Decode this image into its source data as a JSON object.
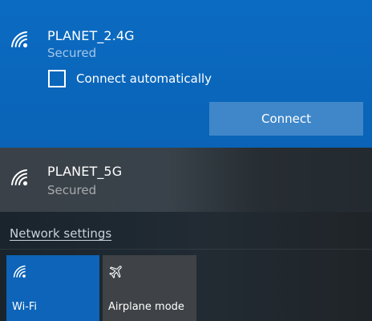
{
  "networks": [
    {
      "name": "PLANET_2.4G",
      "status": "Secured",
      "icon": "wifi-signal-icon",
      "selected": true,
      "connect_automatically_label": "Connect automatically",
      "connect_automatically_checked": false,
      "connect_label": "Connect"
    },
    {
      "name": "PLANET_5G",
      "status": "Secured",
      "icon": "wifi-signal-icon",
      "selected": false
    }
  ],
  "network_settings_label": "Network settings",
  "quick_actions": [
    {
      "label": "Wi-Fi",
      "icon": "wifi-icon",
      "active": true
    },
    {
      "label": "Airplane mode",
      "icon": "airplane-icon",
      "active": false
    }
  ],
  "colors": {
    "accent": "#0b6bc2",
    "connect_button": "#3f87c9",
    "tile_active": "#0d64b8",
    "tile_inactive": "#3f4347",
    "background": "#1c2833"
  }
}
